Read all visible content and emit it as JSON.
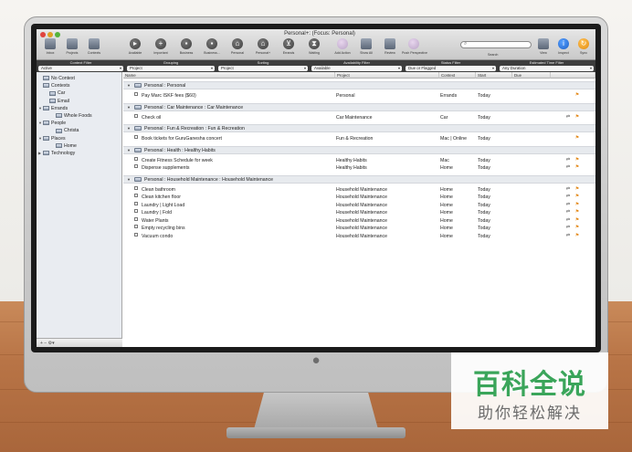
{
  "window": {
    "title": "Personal+: (Focus: Personal)"
  },
  "toolbar": {
    "left": [
      {
        "label": "Inbox",
        "icon": "inbox-icon"
      },
      {
        "label": "Projects",
        "icon": "projects-icon"
      },
      {
        "label": "Contexts",
        "icon": "contexts-icon"
      }
    ],
    "perspectives": [
      {
        "label": "Available",
        "icon": "available-icon"
      },
      {
        "label": "Important",
        "icon": "plus-icon"
      },
      {
        "label": "Business",
        "icon": "briefcase-icon"
      },
      {
        "label": "Business...",
        "icon": "briefcase-icon"
      },
      {
        "label": "Personal",
        "icon": "house-icon"
      },
      {
        "label": "Personal+",
        "icon": "house-icon"
      },
      {
        "label": "Errands",
        "icon": "cart-icon"
      },
      {
        "label": "Waiting",
        "icon": "hourglass-icon"
      }
    ],
    "actions": [
      {
        "label": "Add Action",
        "icon": "add-action-icon"
      },
      {
        "label": "Show All",
        "icon": "show-all-icon"
      },
      {
        "label": "Review",
        "icon": "review-icon"
      },
      {
        "label": "Push Perspective",
        "icon": "push-perspective-icon"
      }
    ],
    "search_label": "Search",
    "right": [
      {
        "label": "View",
        "icon": "view-icon"
      },
      {
        "label": "Inspect",
        "icon": "info-icon"
      },
      {
        "label": "Sync",
        "icon": "sync-icon"
      }
    ]
  },
  "filters": [
    {
      "title": "Context Filter",
      "value": "Active"
    },
    {
      "title": "Grouping",
      "value": "Project"
    },
    {
      "title": "Sorting",
      "value": "Project"
    },
    {
      "title": "Availability Filter",
      "value": "Available"
    },
    {
      "title": "Status Filter",
      "value": "Due or Flagged"
    },
    {
      "title": "Estimated Time Filter",
      "value": "Any Duration"
    }
  ],
  "sidebar": {
    "items": [
      {
        "label": "No Context",
        "indent": 0,
        "disclosure": ""
      },
      {
        "label": "Contexts",
        "indent": 0,
        "disclosure": ""
      },
      {
        "label": "Car",
        "indent": 1,
        "disclosure": ""
      },
      {
        "label": "Email",
        "indent": 1,
        "disclosure": ""
      },
      {
        "label": "Errands",
        "indent": 0,
        "disclosure": "▼"
      },
      {
        "label": "Whole Foods",
        "indent": 2,
        "disclosure": ""
      },
      {
        "label": "People",
        "indent": 0,
        "disclosure": "▼"
      },
      {
        "label": "Christa",
        "indent": 2,
        "disclosure": ""
      },
      {
        "label": "Places",
        "indent": 0,
        "disclosure": "▼"
      },
      {
        "label": "Home",
        "indent": 2,
        "disclosure": ""
      },
      {
        "label": "Technology",
        "indent": 0,
        "disclosure": "▶"
      }
    ],
    "footer": "+  −  ⚙▾"
  },
  "columns": {
    "name": "Name",
    "project": "Project",
    "context": "Context",
    "start": "Start",
    "due": "Due"
  },
  "groups": [
    {
      "title": "Personal : Personal",
      "tasks": [
        {
          "name": "Pay Marc ISKF fees ($60)",
          "project": "Personal",
          "context": "Errands",
          "start": "Today",
          "flag": "orange"
        }
      ]
    },
    {
      "title": "Personal : Car Maintenance : Car Maintenance",
      "tasks": [
        {
          "name": "Check oil",
          "project": "Car Maintenance",
          "context": "Car",
          "start": "Today",
          "flag": "both"
        }
      ]
    },
    {
      "title": "Personal : Fun & Recreation : Fun & Recreation",
      "tasks": [
        {
          "name": "Book tickets for GuruGanesha concert",
          "project": "Fun & Recreation",
          "context": "Mac | Online",
          "start": "Today",
          "flag": "orange"
        }
      ]
    },
    {
      "title": "Personal : Health : Healthy Habits",
      "tasks": [
        {
          "name": "Create Fitness Schedule for week",
          "project": "Healthy Habits",
          "context": "Mac",
          "start": "Today",
          "flag": "both"
        },
        {
          "name": "Dispense supplements",
          "project": "Healthy Habits",
          "context": "Home",
          "start": "Today",
          "flag": "both"
        }
      ]
    },
    {
      "title": "Personal : Household Maintenance : Household Maintenance",
      "tasks": [
        {
          "name": "Clean bathroom",
          "project": "Household Maintenance",
          "context": "Home",
          "start": "Today",
          "flag": "both"
        },
        {
          "name": "Clean kitchen floor",
          "project": "Household Maintenance",
          "context": "Home",
          "start": "Today",
          "flag": "both"
        },
        {
          "name": "Laundry | Light Load",
          "project": "Household Maintenance",
          "context": "Home",
          "start": "Today",
          "flag": "both"
        },
        {
          "name": "Laundry | Fold",
          "project": "Household Maintenance",
          "context": "Home",
          "start": "Today",
          "flag": "both"
        },
        {
          "name": "Water Plants",
          "project": "Household Maintenance",
          "context": "Home",
          "start": "Today",
          "flag": "both"
        },
        {
          "name": "Empty recycling bins",
          "project": "Household Maintenance",
          "context": "Home",
          "start": "Today",
          "flag": "both"
        },
        {
          "name": "Vacuum condo",
          "project": "Household Maintenance",
          "context": "Home",
          "start": "Today",
          "flag": "both"
        }
      ]
    }
  ],
  "watermark": {
    "title": "百科全说",
    "subtitle": "助你轻松解决"
  },
  "colors": {
    "filter_bar": "#3d3d3d",
    "group_row": "#e7eaee",
    "flag_orange": "#e48b1d",
    "watermark_green": "#3aa55a"
  }
}
